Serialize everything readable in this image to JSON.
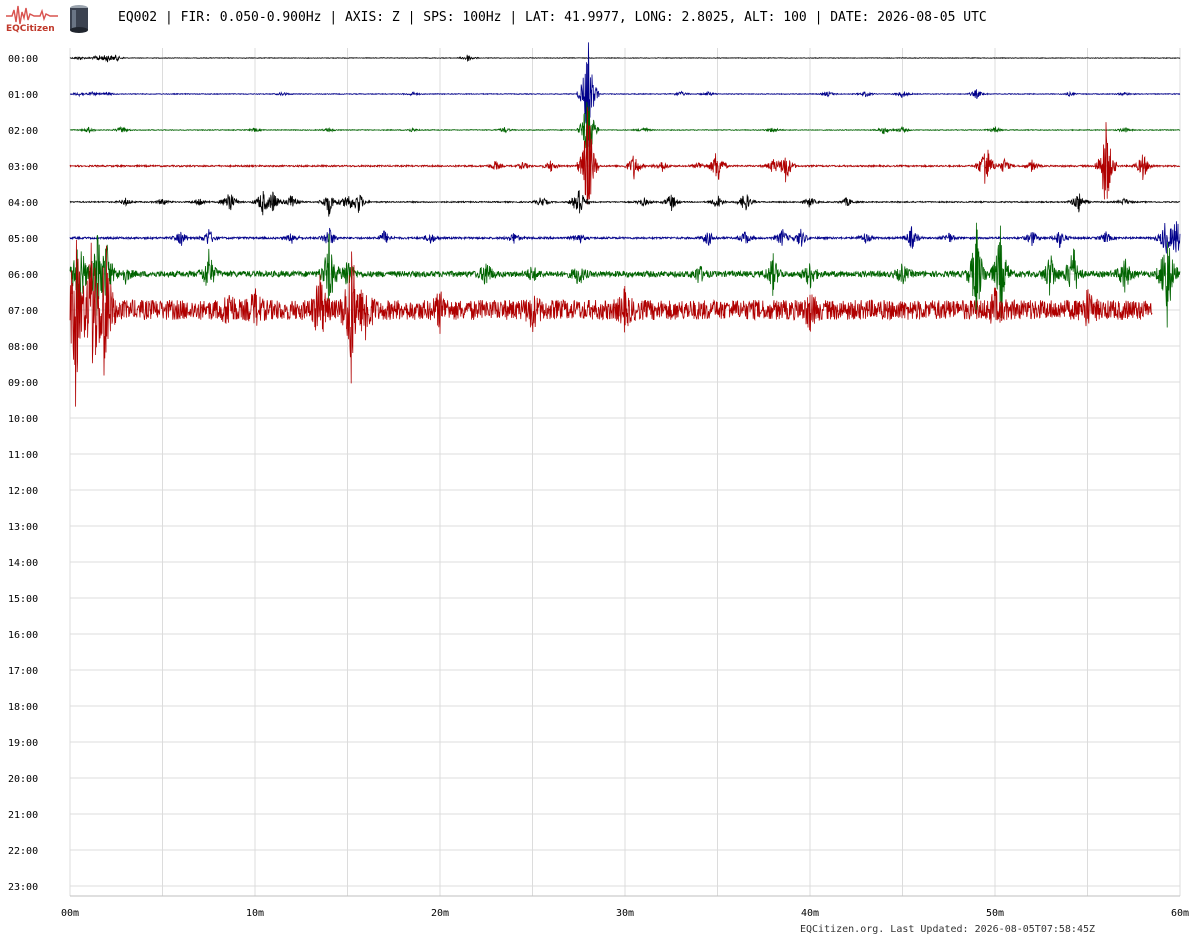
{
  "header": {
    "logo_text": "EQCitizen",
    "title": "EQ002 | FIR: 0.050-0.900Hz | AXIS: Z | SPS: 100Hz | LAT: 41.9977, LONG: 2.8025, ALT: 100 | DATE: 2026-08-05 UTC"
  },
  "footer": {
    "text": "EQCitizen.org. Last Updated: 2026-08-05T07:58:45Z"
  },
  "chart_data": {
    "type": "line",
    "title": "",
    "xlabel": "",
    "ylabel": "",
    "x_ticks": [
      "00m",
      "10m",
      "20m",
      "30m",
      "40m",
      "50m",
      "60m"
    ],
    "xlim": [
      0,
      60
    ],
    "row_labels": [
      "00:00",
      "01:00",
      "02:00",
      "03:00",
      "04:00",
      "05:00",
      "06:00",
      "07:00",
      "08:00",
      "09:00",
      "10:00",
      "11:00",
      "12:00",
      "13:00",
      "14:00",
      "15:00",
      "16:00",
      "17:00",
      "18:00",
      "19:00",
      "20:00",
      "21:00",
      "22:00",
      "23:00"
    ],
    "grid": true,
    "trace_colors": [
      "#000000",
      "#00008b",
      "#006400",
      "#b00000"
    ],
    "series": [
      {
        "hour": "00:00",
        "end_minute": 60,
        "noise": 0.3,
        "events": [
          [
            0.5,
            2
          ],
          [
            1.5,
            3
          ],
          [
            2,
            4
          ],
          [
            2.5,
            3
          ],
          [
            21.5,
            4
          ]
        ]
      },
      {
        "hour": "01:00",
        "end_minute": 60,
        "noise": 0.4,
        "events": [
          [
            0.5,
            2
          ],
          [
            1.2,
            2
          ],
          [
            2,
            2
          ],
          [
            11.5,
            2
          ],
          [
            18.5,
            2
          ],
          [
            28,
            60
          ],
          [
            33,
            3
          ],
          [
            34.5,
            2
          ],
          [
            41,
            3
          ],
          [
            43,
            3
          ],
          [
            45,
            4
          ],
          [
            49,
            5
          ],
          [
            54,
            2
          ],
          [
            57,
            2
          ]
        ]
      },
      {
        "hour": "02:00",
        "end_minute": 60,
        "noise": 0.4,
        "events": [
          [
            1,
            3
          ],
          [
            2.8,
            4
          ],
          [
            10,
            2
          ],
          [
            14,
            2
          ],
          [
            18.5,
            2
          ],
          [
            23.5,
            3
          ],
          [
            28,
            45
          ],
          [
            31,
            3
          ],
          [
            38,
            3
          ],
          [
            44,
            4
          ],
          [
            45,
            3
          ],
          [
            50,
            3
          ],
          [
            57,
            3
          ]
        ]
      },
      {
        "hour": "03:00",
        "end_minute": 60,
        "noise": 0.8,
        "events": [
          [
            23,
            5
          ],
          [
            24.5,
            4
          ],
          [
            26,
            6
          ],
          [
            28,
            70
          ],
          [
            30.5,
            15
          ],
          [
            32,
            6
          ],
          [
            34,
            4
          ],
          [
            35,
            22
          ],
          [
            38,
            8
          ],
          [
            38.7,
            18
          ],
          [
            49.5,
            30
          ],
          [
            50.5,
            8
          ],
          [
            52,
            6
          ],
          [
            56,
            55
          ],
          [
            58,
            15
          ]
        ]
      },
      {
        "hour": "04:00",
        "end_minute": 60,
        "noise": 0.6,
        "events": [
          [
            3,
            4
          ],
          [
            5,
            4
          ],
          [
            7,
            5
          ],
          [
            8.6,
            15
          ],
          [
            10.4,
            14
          ],
          [
            11,
            12
          ],
          [
            12,
            10
          ],
          [
            14,
            15
          ],
          [
            15,
            10
          ],
          [
            15.6,
            12
          ],
          [
            25.5,
            6
          ],
          [
            27.5,
            22
          ],
          [
            31,
            5
          ],
          [
            32.5,
            10
          ],
          [
            35,
            8
          ],
          [
            36.5,
            12
          ],
          [
            40,
            6
          ],
          [
            42,
            5
          ],
          [
            54.5,
            12
          ],
          [
            57,
            4
          ]
        ]
      },
      {
        "hour": "05:00",
        "end_minute": 60,
        "noise": 1.0,
        "events": [
          [
            6,
            8
          ],
          [
            7.5,
            10
          ],
          [
            12,
            6
          ],
          [
            14,
            12
          ],
          [
            17,
            8
          ],
          [
            19.5,
            6
          ],
          [
            24,
            6
          ],
          [
            27.5,
            6
          ],
          [
            34.5,
            8
          ],
          [
            36.5,
            8
          ],
          [
            38.5,
            10
          ],
          [
            39.5,
            10
          ],
          [
            43,
            6
          ],
          [
            45.5,
            12
          ],
          [
            47.5,
            6
          ],
          [
            52,
            8
          ],
          [
            53.5,
            10
          ],
          [
            56,
            6
          ],
          [
            59.2,
            18
          ],
          [
            59.8,
            22
          ]
        ]
      },
      {
        "hour": "06:00",
        "end_minute": 60,
        "noise": 3.0,
        "events": [
          [
            0.5,
            55
          ],
          [
            1.5,
            50
          ],
          [
            2,
            30
          ],
          [
            3,
            8
          ],
          [
            7.5,
            24
          ],
          [
            14,
            40
          ],
          [
            15,
            18
          ],
          [
            22.5,
            15
          ],
          [
            25,
            8
          ],
          [
            27.5,
            12
          ],
          [
            34,
            10
          ],
          [
            38,
            20
          ],
          [
            40,
            15
          ],
          [
            45,
            10
          ],
          [
            49,
            55
          ],
          [
            50.3,
            50
          ],
          [
            53,
            25
          ],
          [
            54.2,
            35
          ],
          [
            57,
            20
          ],
          [
            59.3,
            60
          ]
        ]
      },
      {
        "hour": "07:00",
        "end_minute": 58.5,
        "noise": 10.0,
        "events": [
          [
            0.3,
            90
          ],
          [
            1.2,
            85
          ],
          [
            1.9,
            80
          ],
          [
            8.6,
            15
          ],
          [
            10,
            15
          ],
          [
            13.5,
            35
          ],
          [
            15.2,
            75
          ],
          [
            16,
            30
          ],
          [
            20,
            15
          ],
          [
            25,
            15
          ],
          [
            30,
            15
          ],
          [
            40,
            15
          ],
          [
            50,
            15
          ],
          [
            55,
            15
          ]
        ]
      }
    ]
  }
}
